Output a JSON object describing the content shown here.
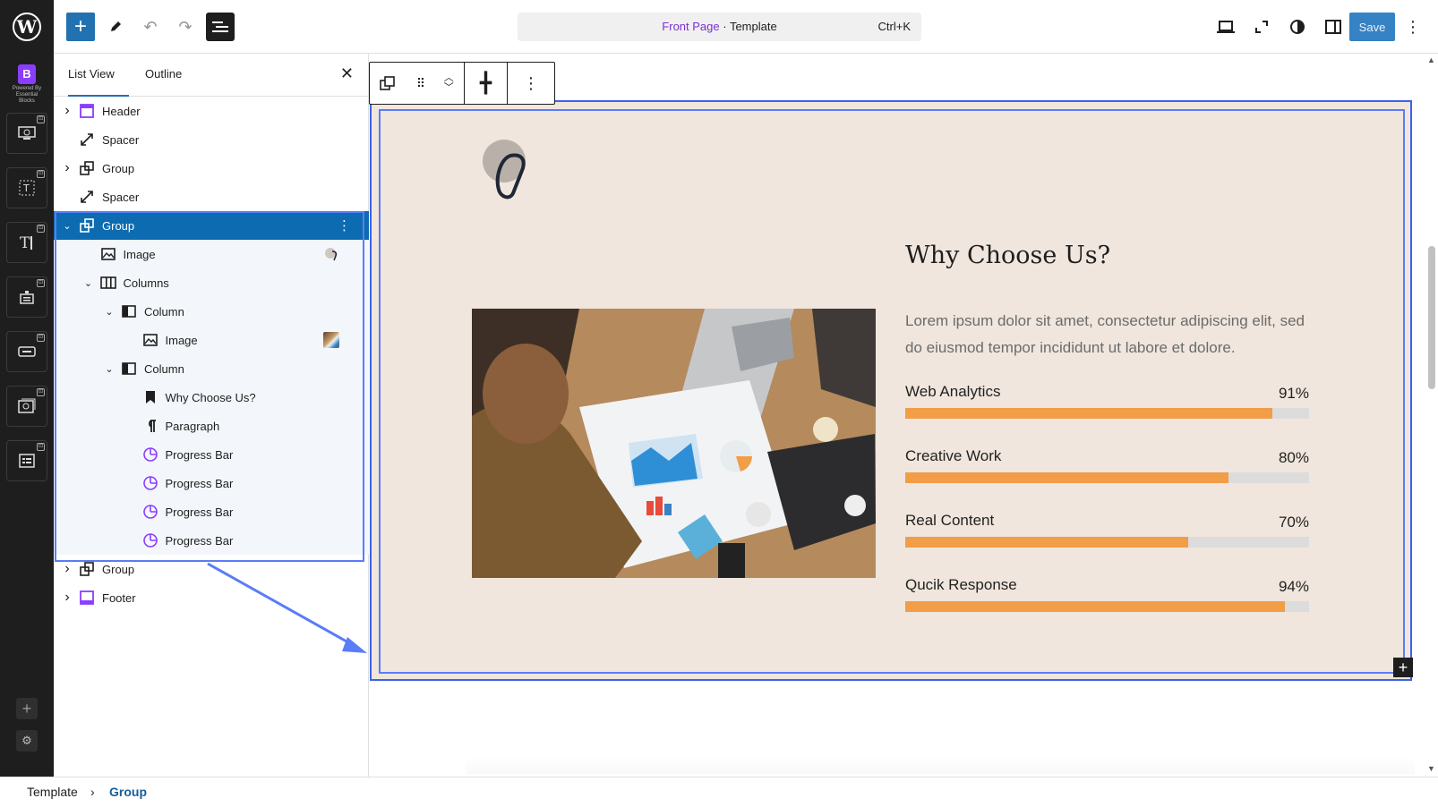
{
  "topbar": {
    "command_bar": {
      "page": "Front Page",
      "separator": " · ",
      "type": "Template",
      "shortcut": "Ctrl+K"
    },
    "save_label": "Save",
    "icons": [
      "wordpress-logo",
      "plus-icon",
      "pencil-icon",
      "undo-icon",
      "redo-icon",
      "document-overview-icon",
      "desktop-preview-icon",
      "fullscreen-icon",
      "styles-contrast-icon",
      "sidebar-toggle-icon",
      "kebab-menu-icon"
    ]
  },
  "rail": {
    "brand": {
      "mark": "B",
      "caption": "Powered By Essential Blocks"
    },
    "items": [
      "templates-icon",
      "text-icon",
      "typography-icon",
      "form-icon",
      "button-icon",
      "image-gallery-icon",
      "list-icon"
    ]
  },
  "list_view": {
    "tabs": [
      "List View",
      "Outline"
    ],
    "rows": [
      {
        "label": "Header",
        "icon": "header-icon",
        "expandable": true,
        "open": false
      },
      {
        "label": "Spacer",
        "icon": "spacer-icon",
        "expandable": false
      },
      {
        "label": "Group",
        "icon": "group-icon",
        "expandable": true,
        "open": false
      },
      {
        "label": "Spacer",
        "icon": "spacer-icon",
        "expandable": false
      },
      {
        "label": "Group",
        "icon": "group-icon",
        "expandable": true,
        "open": true,
        "selected": true
      },
      {
        "label": "Image",
        "icon": "image-icon",
        "thumb": "logo"
      },
      {
        "label": "Columns",
        "icon": "columns-icon",
        "expandable": true,
        "open": true
      },
      {
        "label": "Column",
        "icon": "column-icon",
        "expandable": true,
        "open": true
      },
      {
        "label": "Image",
        "icon": "image-icon",
        "thumb": "photo"
      },
      {
        "label": "Column",
        "icon": "column-icon",
        "expandable": true,
        "open": true
      },
      {
        "label": "Why Choose Us?",
        "icon": "bookmark-icon"
      },
      {
        "label": "Paragraph",
        "icon": "paragraph-icon"
      },
      {
        "label": "Progress Bar",
        "icon": "progress-bar-icon"
      },
      {
        "label": "Progress Bar",
        "icon": "progress-bar-icon"
      },
      {
        "label": "Progress Bar",
        "icon": "progress-bar-icon"
      },
      {
        "label": "Progress Bar",
        "icon": "progress-bar-icon"
      },
      {
        "label": "Group",
        "icon": "group-icon",
        "expandable": true,
        "open": false
      },
      {
        "label": "Footer",
        "icon": "footer-icon",
        "expandable": true,
        "open": false
      }
    ]
  },
  "content": {
    "heading": "Why Choose Us?",
    "paragraph": "Lorem ipsum dolor sit amet, consectetur adipiscing elit, sed do eiusmod tempor incididunt ut labore et dolore.",
    "progress": [
      {
        "label": "Web Analytics",
        "value": 91,
        "display": "91%"
      },
      {
        "label": "Creative Work",
        "value": 80,
        "display": "80%"
      },
      {
        "label": "Real Content",
        "value": 70,
        "display": "70%"
      },
      {
        "label": "Qucik Response",
        "value": 94,
        "display": "94%"
      }
    ],
    "colors": {
      "section_bg": "#f0e6dd",
      "bar_fill": "#f29d47",
      "bar_track": "#dcdcdc",
      "selection": "#3a63e8"
    }
  },
  "breadcrumb": {
    "items": [
      "Template",
      "Group"
    ],
    "separator": "›"
  }
}
